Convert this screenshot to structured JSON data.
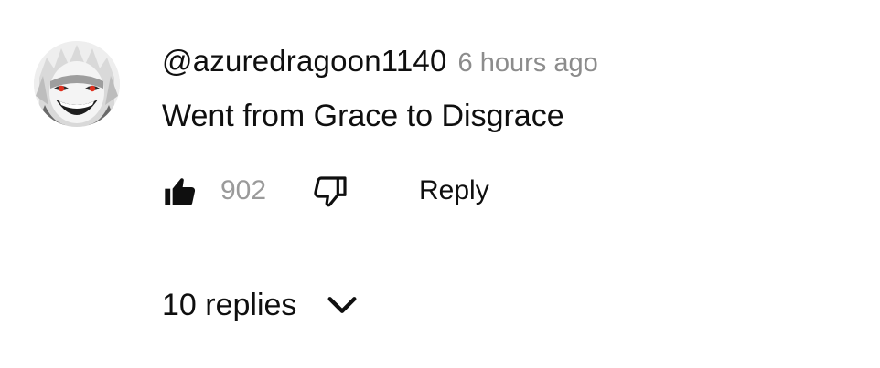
{
  "comment": {
    "author": "@azuredragoon1140",
    "timestamp": "6 hours ago",
    "text": "Went from Grace to Disgrace",
    "like_count": "902",
    "reply_label": "Reply",
    "replies_label": "10 replies"
  },
  "icons": {
    "like": "thumbs-up-icon",
    "dislike": "thumbs-down-icon",
    "expand": "chevron-down-icon"
  },
  "colors": {
    "text": "#0f0f0f",
    "muted": "#8c8c8c"
  }
}
